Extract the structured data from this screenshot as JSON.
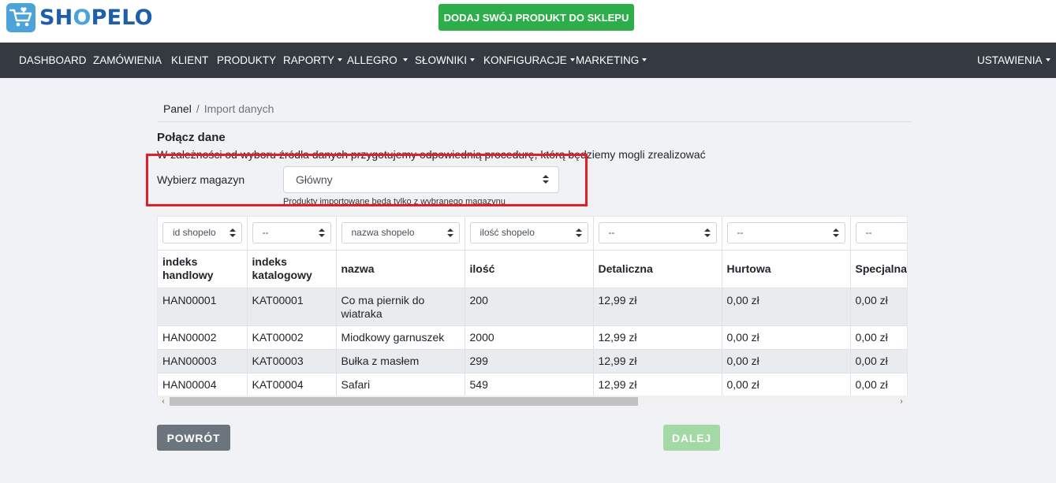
{
  "brand": {
    "name_prefix": "SH",
    "name_o": "O",
    "name_suffix": "PELO",
    "logo_icon": "shopping-cart-icon",
    "primary_color": "#1f5ea8",
    "accent_color": "#4ba3d9"
  },
  "header": {
    "add_product_label": "DODAJ SWÓJ PRODUKT DO SKLEPU",
    "add_product_color": "#2eae4a"
  },
  "nav": {
    "items": [
      {
        "label": "DASHBOARD",
        "dropdown": false
      },
      {
        "label": "ZAMÓWIENIA",
        "dropdown": false
      },
      {
        "label": "KLIENT",
        "dropdown": false
      },
      {
        "label": "PRODUKTY",
        "dropdown": false
      },
      {
        "label": "RAPORTY",
        "dropdown": true
      },
      {
        "label": "ALLEGRO",
        "dropdown": true
      },
      {
        "label": "SŁOWNIKI",
        "dropdown": true
      },
      {
        "label": "KONFIGURACJE",
        "dropdown": true
      },
      {
        "label": "MARKETING",
        "dropdown": true
      }
    ],
    "settings": {
      "label": "USTAWIENIA",
      "dropdown": true
    }
  },
  "breadcrumb": {
    "home": "Panel",
    "separator": "/",
    "current": "Import danych"
  },
  "section": {
    "title": "Połącz dane",
    "description": "W zależności od wyboru źródła danych przygotujemy odpowiednią procedurę, którą będziemy mogli zrealizować"
  },
  "warehouse": {
    "label": "Wybierz magazyn",
    "selected": "Główny",
    "help": "Produkty importowane będą tylko z wybranego magazynu"
  },
  "table": {
    "mapping": [
      "id shopelo",
      "--",
      "nazwa shopelo",
      "ilość shopelo",
      "--",
      "--",
      "--"
    ],
    "headers": [
      "indeks handlowy",
      "indeks katalogowy",
      "nazwa",
      "ilość",
      "Detaliczna",
      "Hurtowa",
      "Specjalna"
    ],
    "rows": [
      [
        "HAN00001",
        "KAT00001",
        "Co ma piernik do wiatraka",
        "200",
        "12,99 zł",
        "0,00 zł",
        "0,00 zł"
      ],
      [
        "HAN00002",
        "KAT00002",
        "Miodkowy garnuszek",
        "2000",
        "12,99 zł",
        "0,00 zł",
        "0,00 zł"
      ],
      [
        "HAN00003",
        "KAT00003",
        "Bułka z masłem",
        "299",
        "12,99 zł",
        "0,00 zł",
        "0,00 zł"
      ],
      [
        "HAN00004",
        "KAT00004",
        "Safari",
        "549",
        "12,99 zł",
        "0,00 zł",
        "0,00 zł"
      ]
    ]
  },
  "scrollbar": {
    "left_arrow": "‹",
    "right_arrow": "›"
  },
  "actions": {
    "back_label": "POWRÓT",
    "next_label": "DALEJ"
  }
}
